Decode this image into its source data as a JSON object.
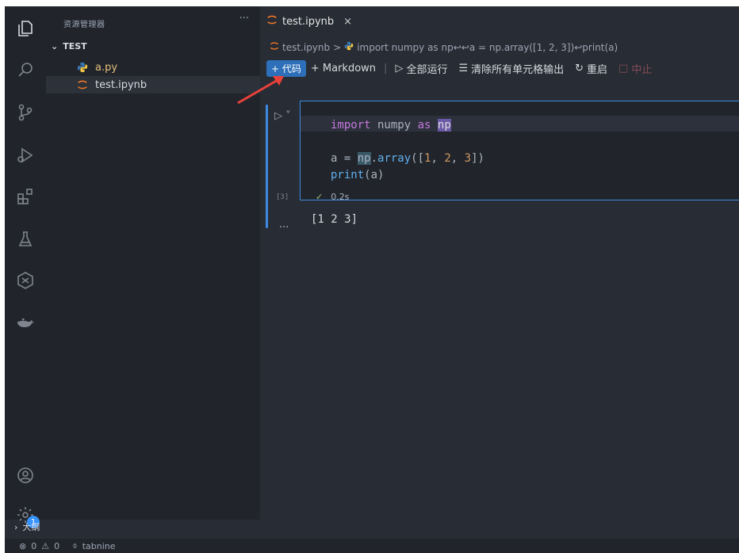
{
  "sidebar": {
    "header": "资源管理器",
    "more": "···",
    "folder": "TEST",
    "files": [
      {
        "name": "a.py",
        "icon": "python-icon"
      },
      {
        "name": "test.ipynb",
        "icon": "jupyter-icon"
      }
    ],
    "outline": "大纲"
  },
  "tab": {
    "title": "test.ipynb",
    "close": "×"
  },
  "breadcrumb": {
    "file": "test.ipynb",
    "sep": ">",
    "cell": "import numpy as np↩↩a = np.array([1, 2, 3])↩print(a)"
  },
  "toolbar": {
    "add_code": "+ 代码",
    "add_markdown": "+ Markdown",
    "run_all": "全部运行",
    "clear_outputs": "清除所有单元格输出",
    "restart": "重启",
    "interrupt": "中止"
  },
  "cell": {
    "lines": [
      "import numpy as np",
      "",
      "a = np.array([1, 2, 3])",
      "print(a)"
    ],
    "execution_count": "[3]",
    "check": "✓",
    "duration": "0.2s",
    "output_more": "...",
    "output": "[1 2 3]"
  },
  "status": {
    "errors": "0",
    "warnings": "0",
    "extension": "tabnine"
  },
  "activity": {
    "badge": "1"
  },
  "colors": {
    "accent": "#3c8ae0",
    "sidebar_bg": "#21252b",
    "editor_bg": "#282c34",
    "arrow": "#e8413a"
  }
}
